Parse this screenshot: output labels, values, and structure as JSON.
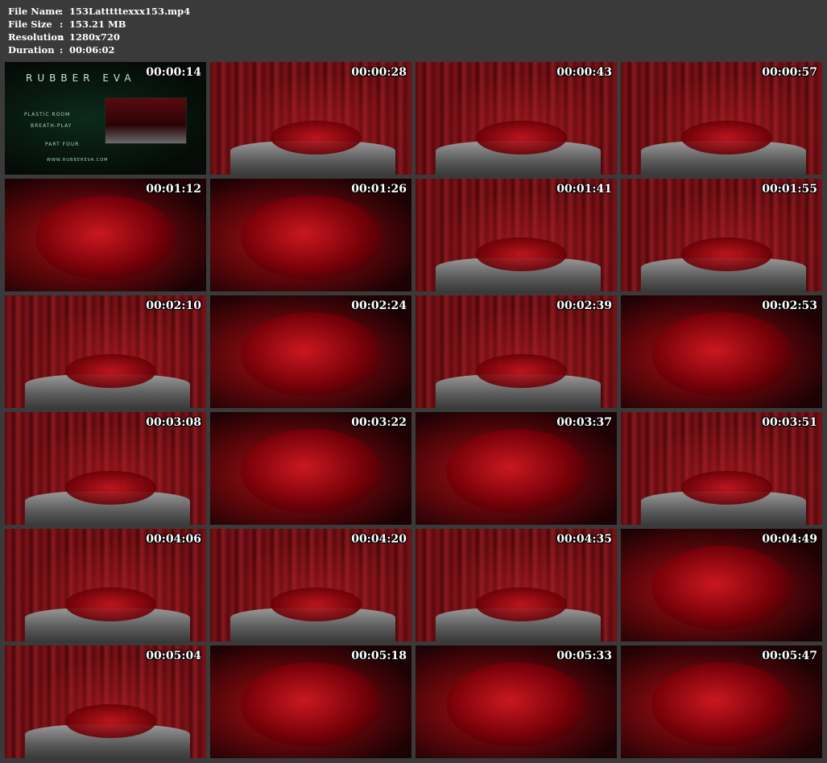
{
  "info": {
    "filename_label": "File Name",
    "filename_value": "153Latttttexxx153.mp4",
    "filesize_label": "File Size",
    "filesize_value": "153.21 MB",
    "resolution_label": "Resolution",
    "resolution_value": "1280x720",
    "duration_label": "Duration",
    "duration_value": "00:06:02",
    "separator": ":"
  },
  "title_card": {
    "brand": "RUBBER EVA",
    "line1": "PLASTIC ROOM",
    "line2": "BREATH-PLAY",
    "line3": "PART FOUR",
    "site": "WWW.RUBBEREVA.COM"
  },
  "thumbnails": [
    {
      "time": "00:00:14",
      "kind": "title"
    },
    {
      "time": "00:00:28",
      "kind": "bed"
    },
    {
      "time": "00:00:43",
      "kind": "bed"
    },
    {
      "time": "00:00:57",
      "kind": "bed"
    },
    {
      "time": "00:01:12",
      "kind": "close"
    },
    {
      "time": "00:01:26",
      "kind": "close"
    },
    {
      "time": "00:01:41",
      "kind": "bed"
    },
    {
      "time": "00:01:55",
      "kind": "bed"
    },
    {
      "time": "00:02:10",
      "kind": "bed"
    },
    {
      "time": "00:02:24",
      "kind": "close"
    },
    {
      "time": "00:02:39",
      "kind": "bed"
    },
    {
      "time": "00:02:53",
      "kind": "close"
    },
    {
      "time": "00:03:08",
      "kind": "bed"
    },
    {
      "time": "00:03:22",
      "kind": "close"
    },
    {
      "time": "00:03:37",
      "kind": "close"
    },
    {
      "time": "00:03:51",
      "kind": "bed"
    },
    {
      "time": "00:04:06",
      "kind": "bed"
    },
    {
      "time": "00:04:20",
      "kind": "bed"
    },
    {
      "time": "00:04:35",
      "kind": "bed"
    },
    {
      "time": "00:04:49",
      "kind": "close"
    },
    {
      "time": "00:05:04",
      "kind": "bed"
    },
    {
      "time": "00:05:18",
      "kind": "close"
    },
    {
      "time": "00:05:33",
      "kind": "close"
    },
    {
      "time": "00:05:47",
      "kind": "close"
    }
  ]
}
